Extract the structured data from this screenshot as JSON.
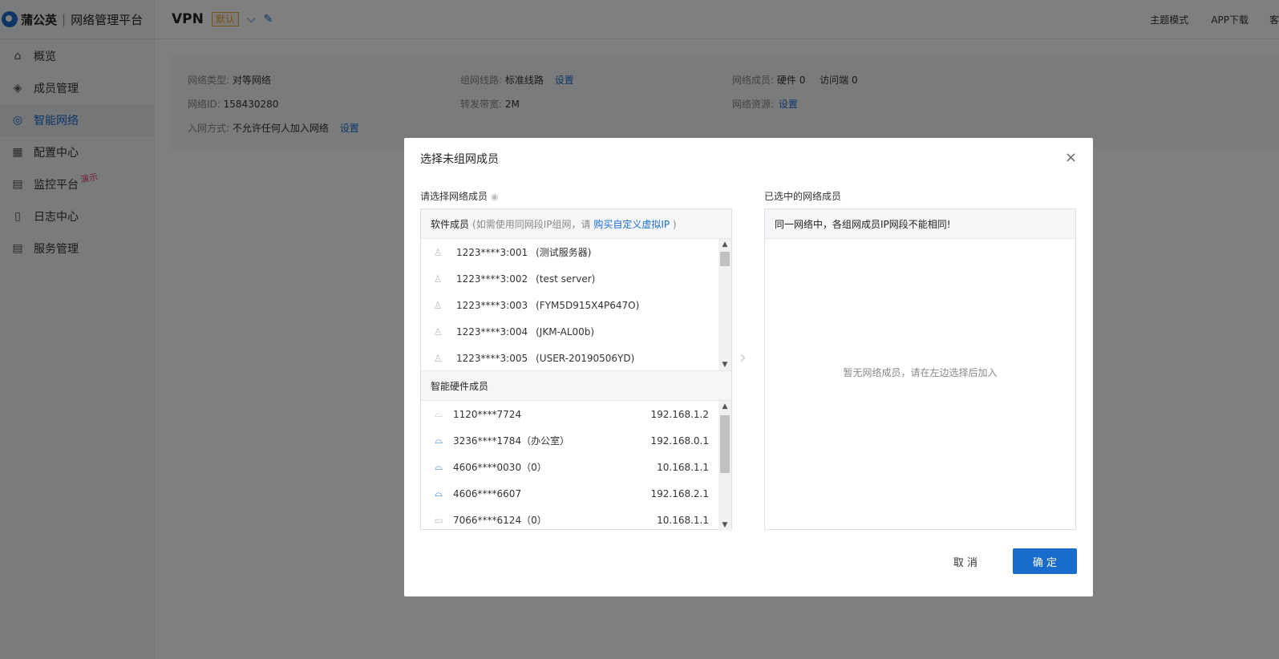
{
  "app": {
    "brand": "蒲公英",
    "platform": "网络管理平台"
  },
  "sidebar": {
    "items": [
      {
        "label": "概览"
      },
      {
        "label": "成员管理"
      },
      {
        "label": "智能网络"
      },
      {
        "label": "配置中心"
      },
      {
        "label": "监控平台",
        "tag": "演示"
      },
      {
        "label": "日志中心"
      },
      {
        "label": "服务管理"
      }
    ]
  },
  "header": {
    "title": "VPN",
    "badge": "默认",
    "right": [
      "主题模式",
      "APP下载",
      "客"
    ]
  },
  "info": {
    "network_type_key": "网络类型:",
    "network_type": "对等网络",
    "line_key": "组网线路:",
    "line": "标准线路",
    "line_link": "设置",
    "members_key": "网络成员:",
    "members_hw": "硬件 0",
    "members_visit": "访问端 0",
    "id_key": "网络ID:",
    "id": "158430280",
    "bandwidth_key": "转发带宽:",
    "bandwidth": "2M",
    "resource_key": "网络资源:",
    "resource_link": "设置",
    "join_key": "入网方式:",
    "join": "不允许任何人加入网络",
    "join_link": "设置"
  },
  "modal": {
    "title": "选择未组网成员",
    "left_label": "请选择网络成员",
    "right_label": "已选中的网络成员",
    "software_head": "软件成员",
    "software_hint_pre": "(如需使用同网段IP组网，请",
    "software_hint_link": "购买自定义虚拟IP",
    "software_hint_post": ")",
    "hardware_head": "智能硬件成员",
    "software_members": [
      {
        "id": "1223****3:001",
        "note": "(测试服务器)"
      },
      {
        "id": "1223****3:002",
        "note": "(test server)"
      },
      {
        "id": "1223****3:003",
        "note": "(FYM5D915X4P647O)"
      },
      {
        "id": "1223****3:004",
        "note": "(JKM-AL00b)"
      },
      {
        "id": "1223****3:005",
        "note": "(USER-20190506YD)"
      }
    ],
    "hardware_members": [
      {
        "name": "1120****7724",
        "ip": "192.168.1.2",
        "online": false
      },
      {
        "name": "3236****1784（办公室）",
        "ip": "192.168.0.1",
        "online": true
      },
      {
        "name": "4606****0030（0）",
        "ip": "10.168.1.1",
        "online": true
      },
      {
        "name": "4606****6607",
        "ip": "192.168.2.1",
        "online": true
      },
      {
        "name": "7066****6124（0）",
        "ip": "10.168.1.1",
        "online": false
      }
    ],
    "right_head": "同一网络中，各组网成员IP网段不能相同!",
    "empty_text": "暂无网络成员，请在左边选择后加入",
    "cancel": "取 消",
    "ok": "确 定"
  }
}
